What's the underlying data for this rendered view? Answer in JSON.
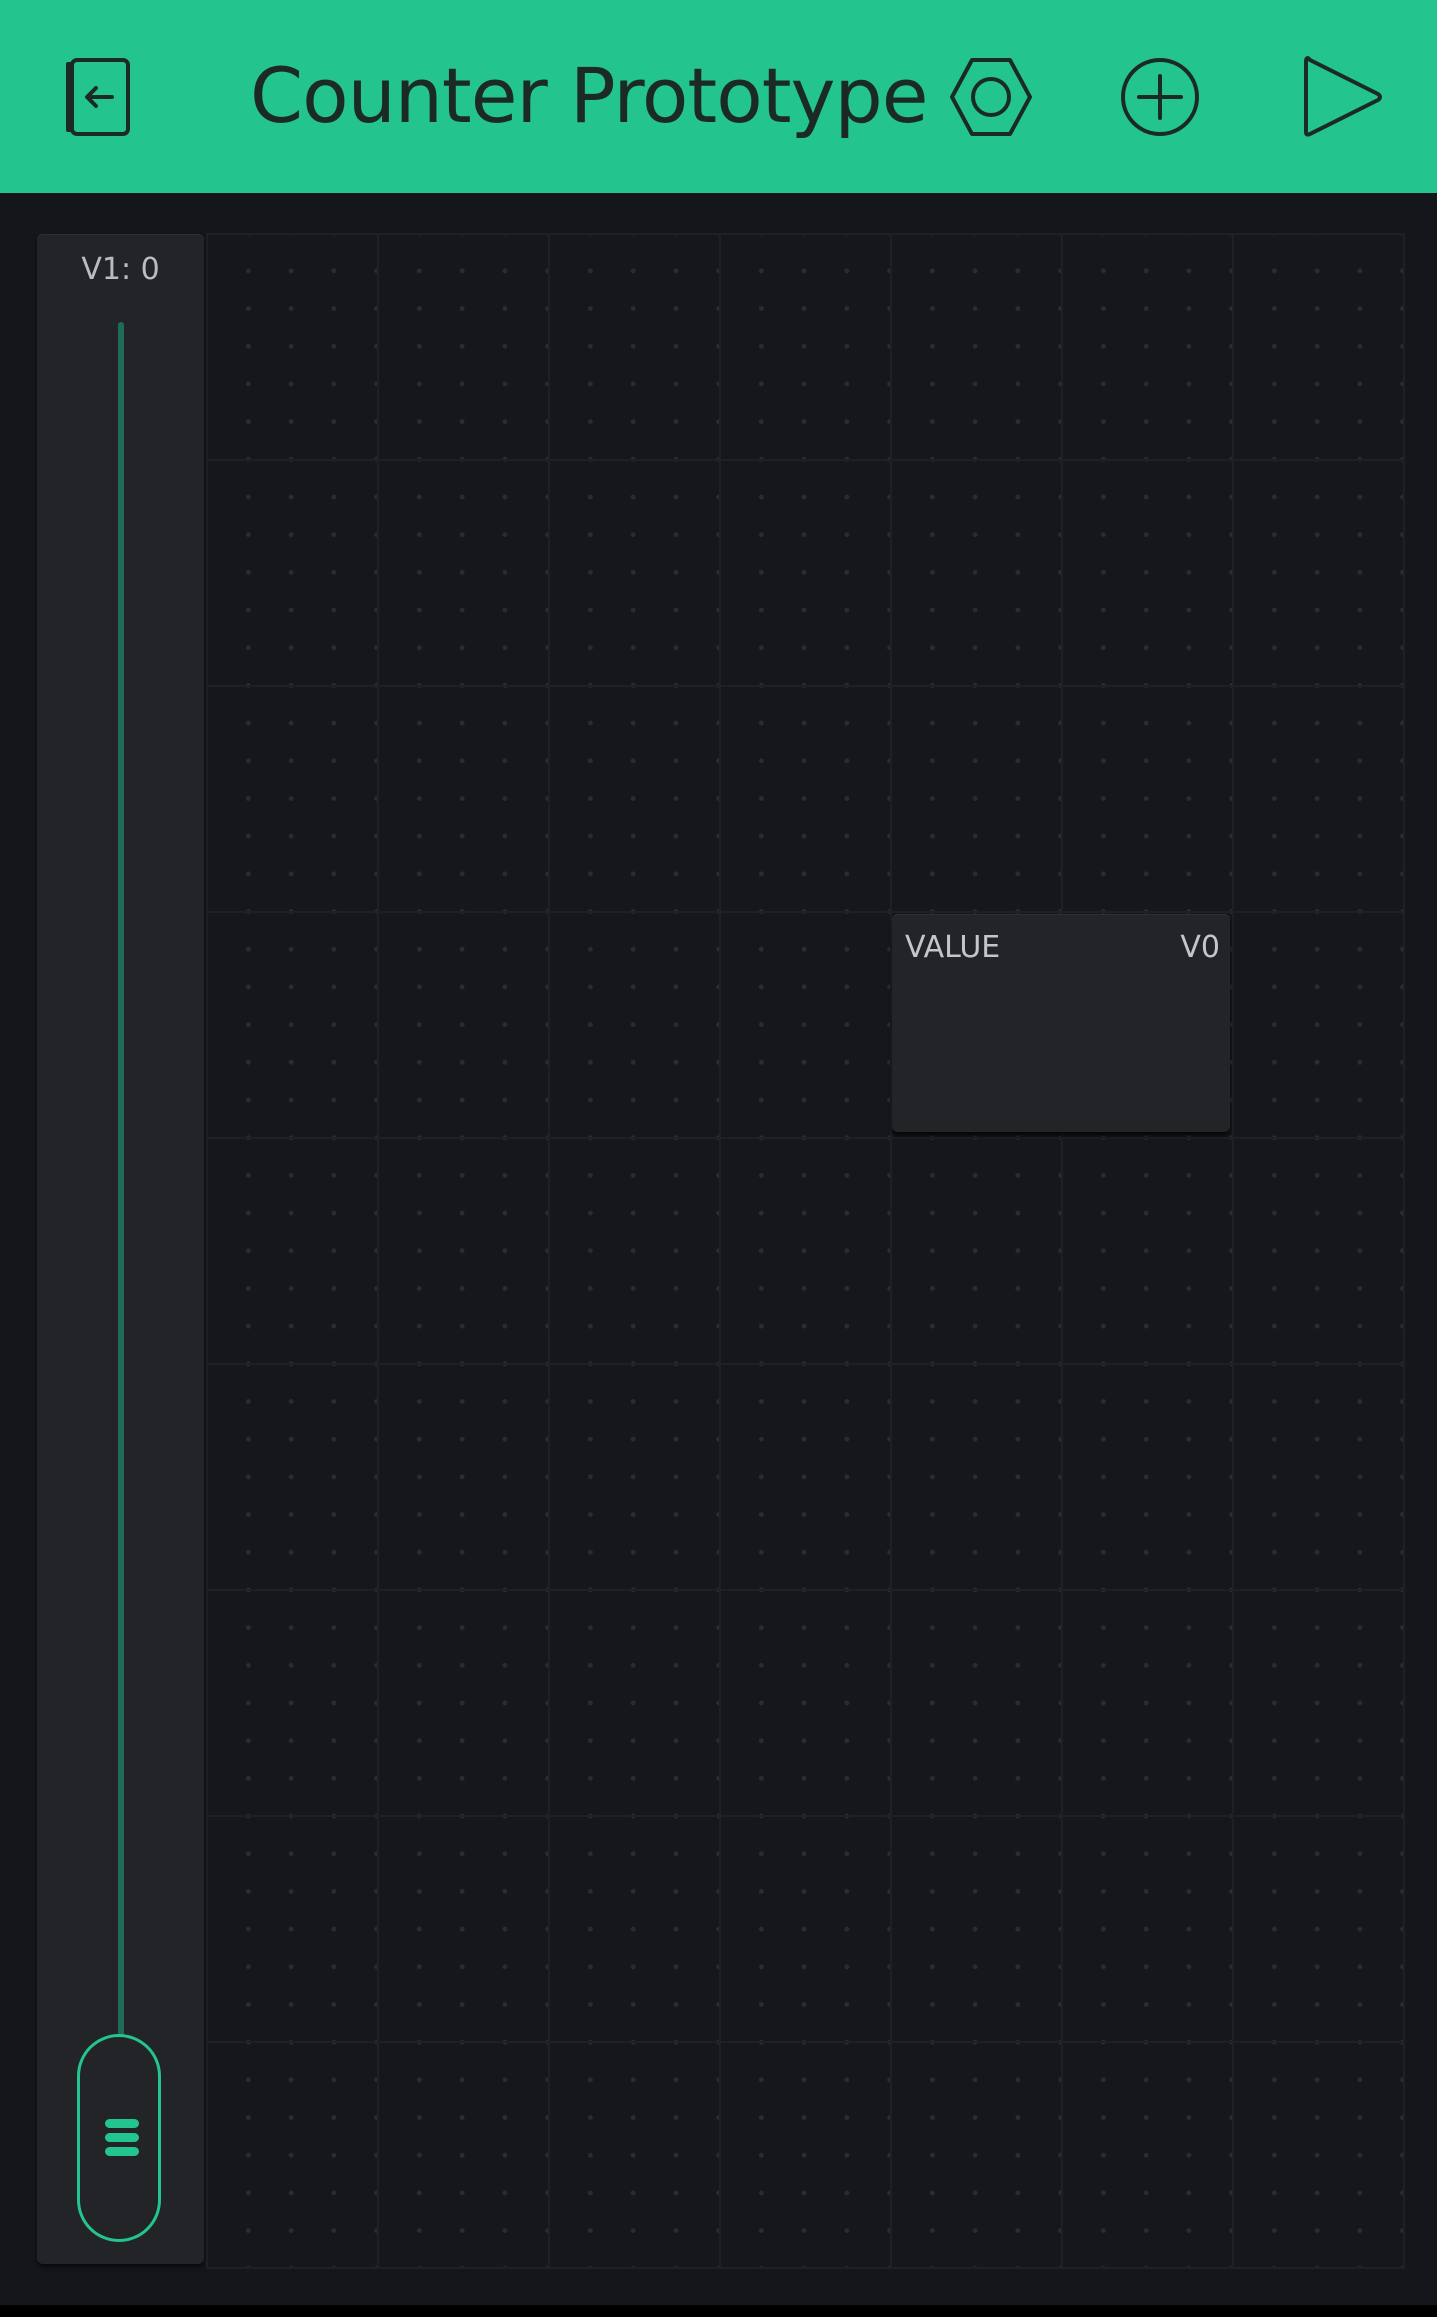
{
  "header": {
    "title": "Counter Prototype",
    "icons": {
      "back": "exit-project-icon",
      "settings": "hexagon-settings-icon",
      "add": "add-widget-icon",
      "play": "play-icon"
    }
  },
  "widgets": {
    "slider": {
      "label": "V1: 0",
      "value": 0,
      "orientation": "vertical"
    },
    "value_display": {
      "label": "VALUE",
      "pin": "V0"
    }
  },
  "colors": {
    "accent": "#23c48e",
    "header_text": "#1b2a26",
    "background": "#15161b",
    "widget": "#232428"
  }
}
